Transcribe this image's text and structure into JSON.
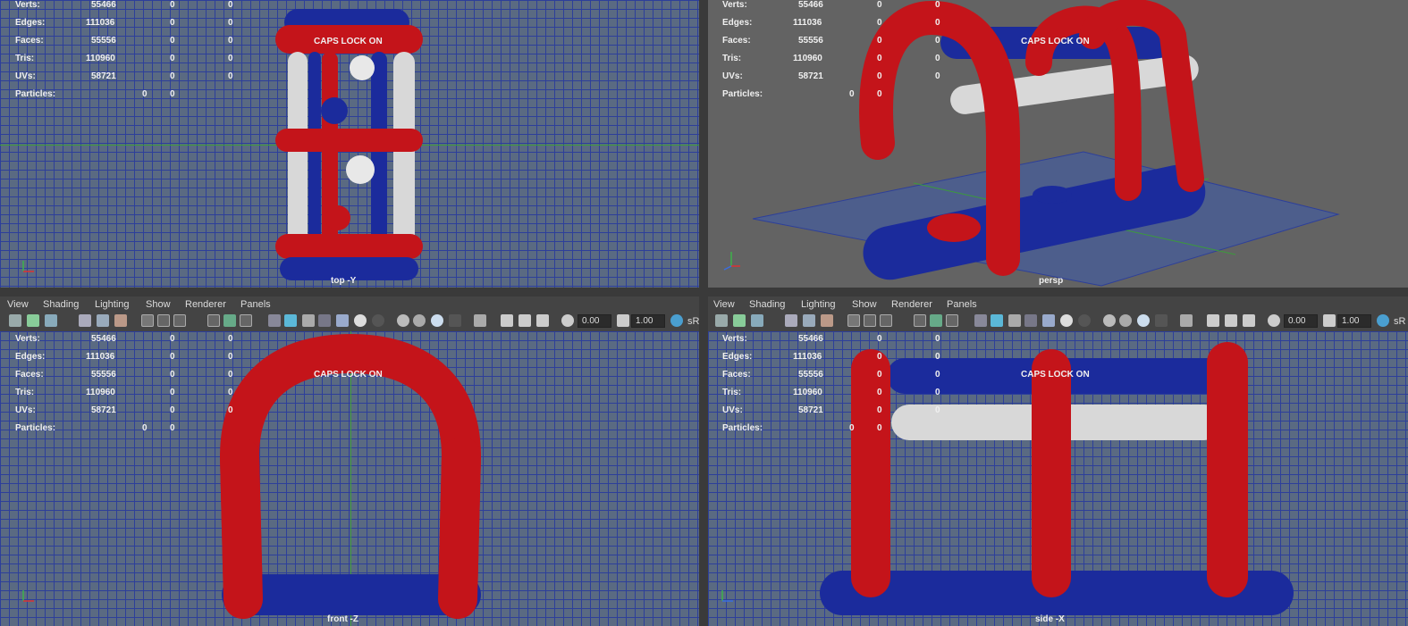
{
  "hud": {
    "labels": [
      "Verts:",
      "Edges:",
      "Faces:",
      "Tris:",
      "UVs:",
      "Particles:"
    ],
    "values": [
      "55466",
      "111036",
      "55556",
      "110960",
      "58721",
      "0"
    ],
    "col2": [
      "0",
      "0",
      "0",
      "0",
      "0",
      "0"
    ],
    "col3": [
      "0",
      "0",
      "0",
      "0",
      "0",
      ""
    ]
  },
  "caps_lock": "CAPS LOCK ON",
  "cameras": {
    "top": "top -Y",
    "persp": "persp",
    "front": "front -Z",
    "side": "side -X"
  },
  "menu": [
    "View",
    "Shading",
    "Lighting",
    "Show",
    "Renderer",
    "Panels"
  ],
  "toolbar": {
    "exposure": "0.00",
    "gamma": "1.00",
    "colorspace": "sR"
  },
  "colors": {
    "red": "#c4141a",
    "blue": "#1b2b9c",
    "white": "#d8d8d8",
    "grid": "#2d3f9a",
    "bg": "#5a6a82"
  }
}
